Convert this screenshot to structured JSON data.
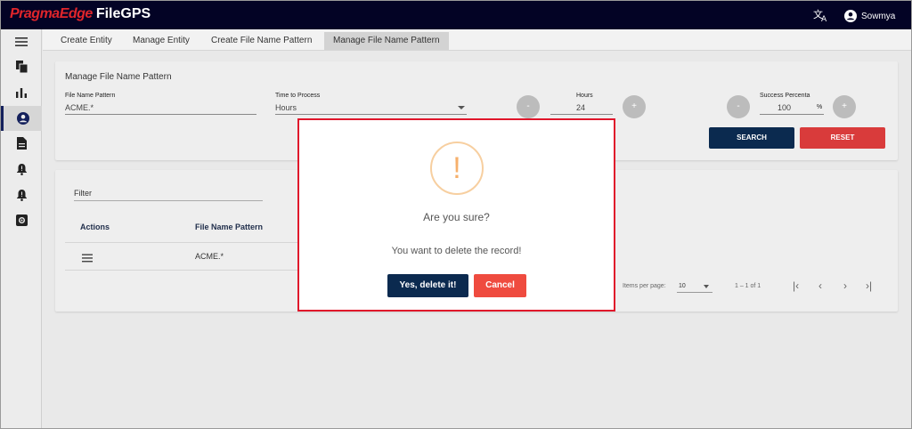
{
  "app": {
    "brand_part1": "PragmaEdge",
    "brand_part2": "FileGPS",
    "user_name": "Sowmya"
  },
  "sidebar": {
    "items": [
      {
        "icon": "menu-icon"
      },
      {
        "icon": "files-icon"
      },
      {
        "icon": "bar-chart-icon"
      },
      {
        "icon": "account-circle-icon"
      },
      {
        "icon": "document-icon"
      },
      {
        "icon": "bell-alert-icon"
      },
      {
        "icon": "bell-alert-icon"
      },
      {
        "icon": "settings-box-icon"
      }
    ]
  },
  "tabs": [
    {
      "label": "Create Entity"
    },
    {
      "label": "Manage Entity"
    },
    {
      "label": "Create File Name Pattern"
    },
    {
      "label": "Manage File Name Pattern"
    }
  ],
  "form": {
    "title": "Manage File Name Pattern",
    "pattern_label": "File Name Pattern",
    "pattern_value": "ACME.*",
    "time_label": "Time to Process",
    "time_value": "Hours",
    "hours_label": "Hours",
    "hours_value": "24",
    "success_label": "Success Percenta",
    "success_value": "100",
    "success_unit": "%",
    "minus": "-",
    "plus": "+",
    "search_label": "SEARCH",
    "reset_label": "RESET"
  },
  "table": {
    "filter_label": "Filter",
    "headers": {
      "actions": "Actions",
      "pattern": "File Name Pattern"
    },
    "rows": [
      {
        "pattern": "ACME.*"
      }
    ],
    "items_per_page_label": "Items per page:",
    "items_per_page_value": "10",
    "range": "1 – 1 of 1"
  },
  "modal": {
    "icon_glyph": "!",
    "title": "Are you sure?",
    "text": "You want to delete the record!",
    "confirm_label": "Yes, delete it!",
    "cancel_label": "Cancel"
  },
  "colors": {
    "topbar": "#030325",
    "brand_red": "#e0252b",
    "primary": "#0b2a4f",
    "reset": "#d93b3b",
    "cancel": "#ef4b3f",
    "modal_border": "#e0162b",
    "warning": "#f6b06b"
  }
}
